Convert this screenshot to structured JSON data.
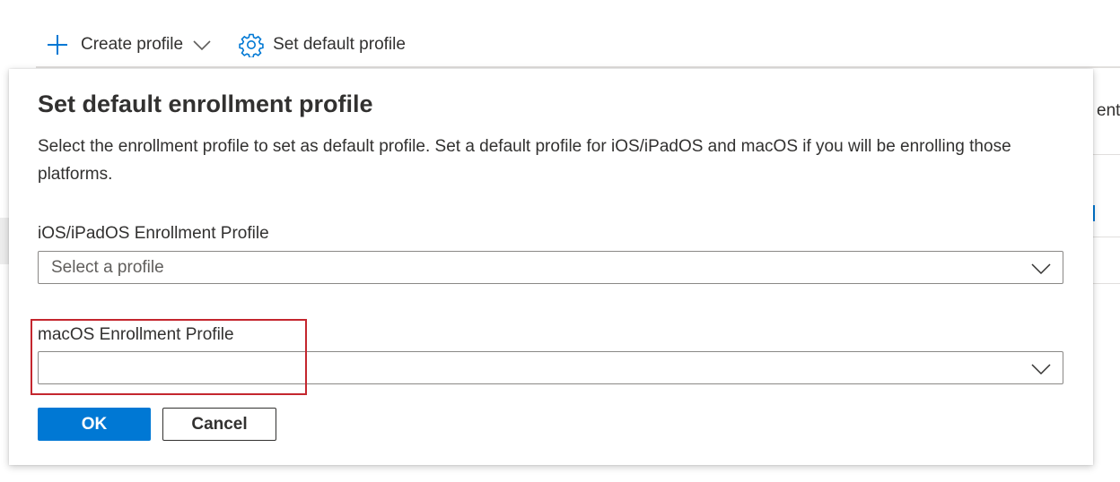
{
  "toolbar": {
    "create_label": "Create profile",
    "default_label": "Set default profile"
  },
  "background": {
    "column_header_fragment": "ent"
  },
  "dialog": {
    "title": "Set default enrollment profile",
    "description": "Select the enrollment profile to set as default profile. Set a default profile for iOS/iPadOS and macOS if you will be enrolling those platforms.",
    "ios_field": {
      "label": "iOS/iPadOS Enrollment Profile",
      "placeholder": "Select a profile",
      "value": ""
    },
    "mac_field": {
      "label": "macOS Enrollment Profile",
      "value": ""
    },
    "ok_label": "OK",
    "cancel_label": "Cancel"
  },
  "colors": {
    "accent": "#0078d4",
    "highlight": "#c4262e",
    "text": "#323130"
  },
  "icons": {
    "create": "plus-icon",
    "create_menu": "chevron-down-icon",
    "default": "gear-icon",
    "dropdown": "chevron-down-icon"
  }
}
